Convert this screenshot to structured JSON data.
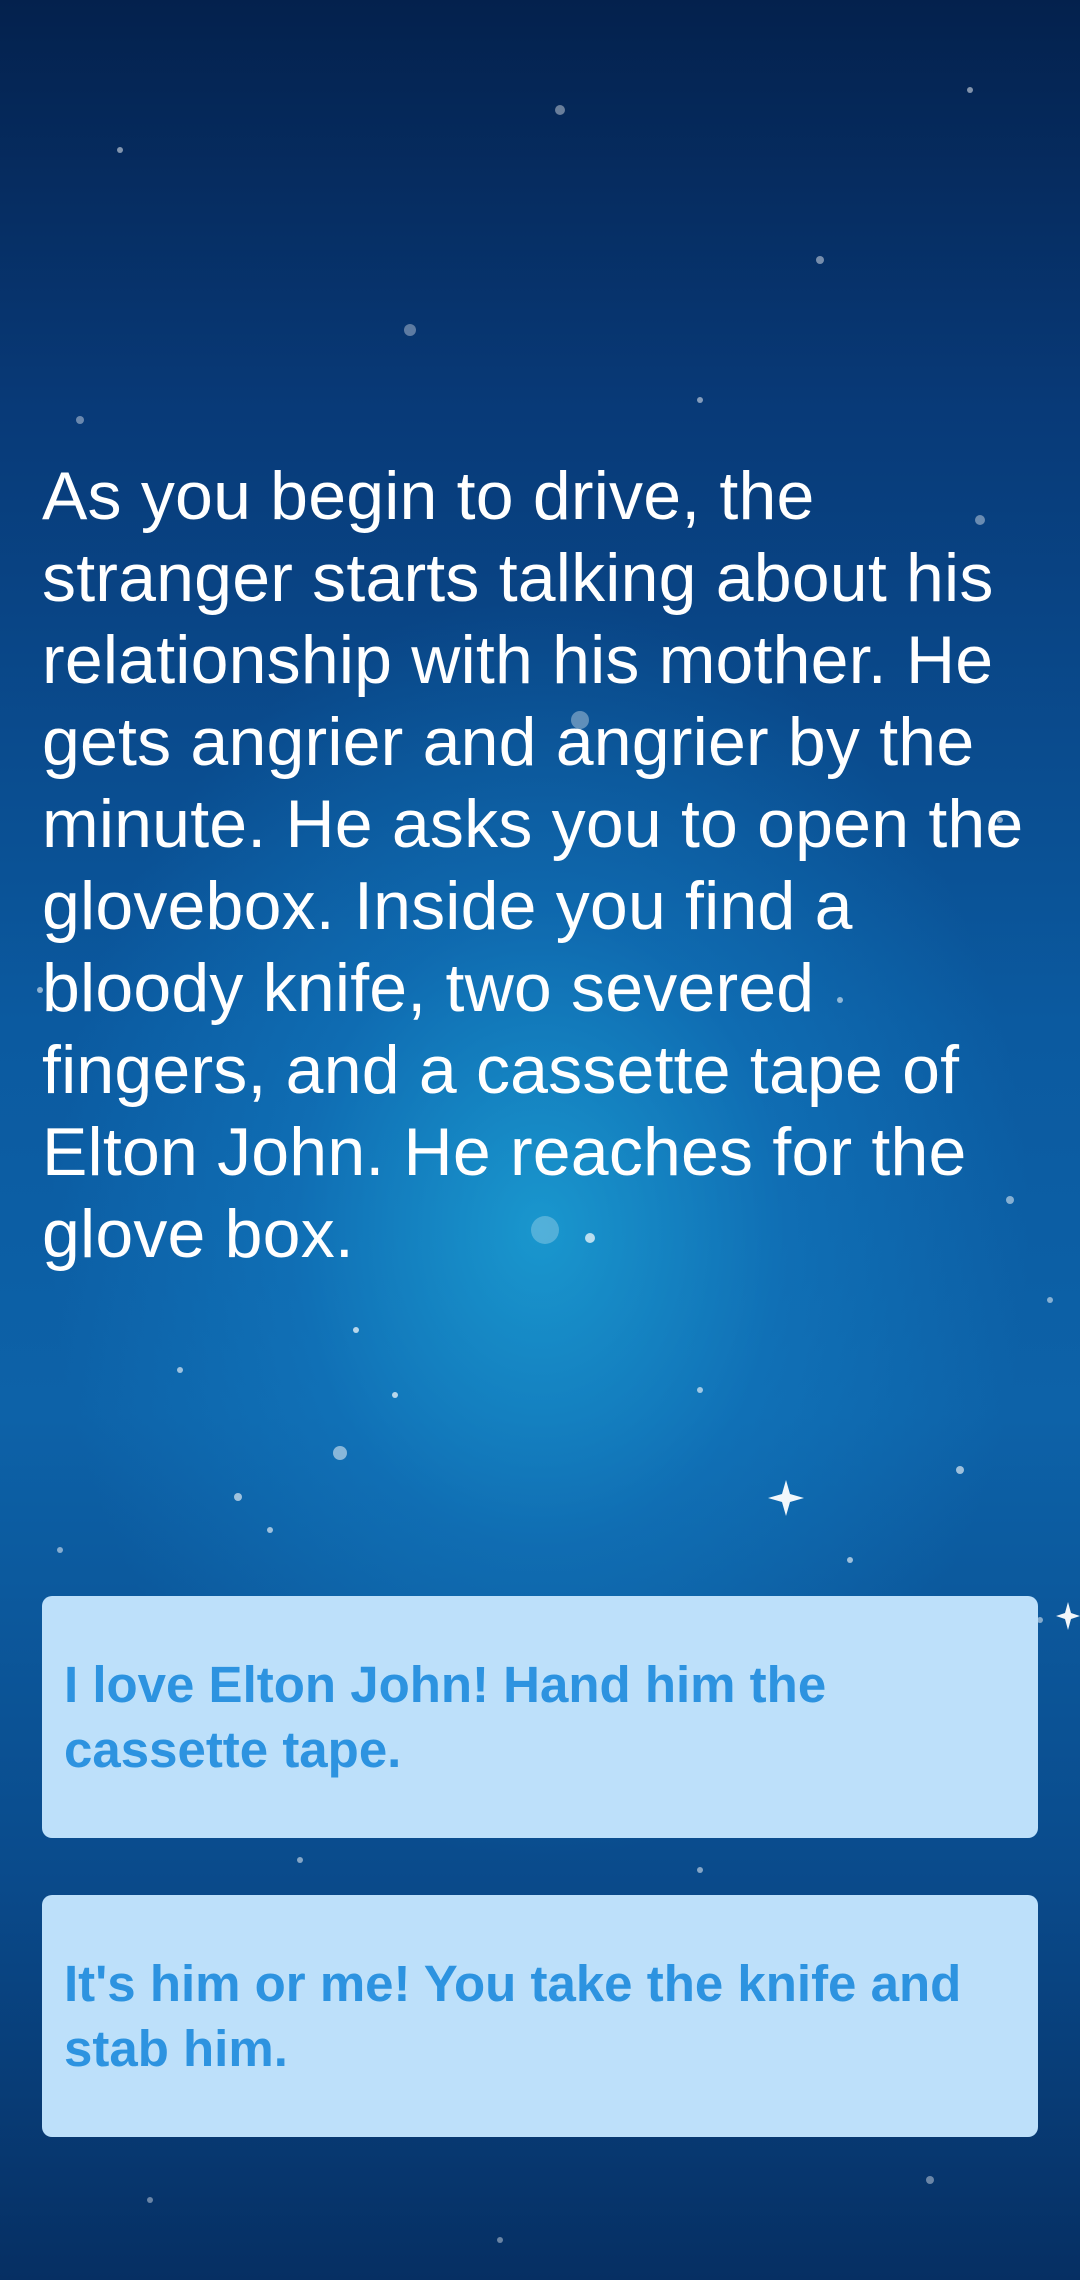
{
  "story": {
    "text": "As you begin to drive, the stranger starts talking about his relationship with his mother. He gets angrier and angrier by the minute. He asks you to open the glovebox. Inside you find a bloody knife, two severed fingers, and a cassette tape of Elton John. He reaches for the glove box."
  },
  "choices": [
    {
      "label": "I love Elton John! Hand him the cassette tape."
    },
    {
      "label": "It's him or me! You take the knife and stab him."
    }
  ],
  "colors": {
    "choice_background": "#bde0fa",
    "choice_text": "#2d93e0",
    "story_text": "#ffffff",
    "background_dark": "#04214d",
    "background_glow": "#1eaadc"
  }
}
